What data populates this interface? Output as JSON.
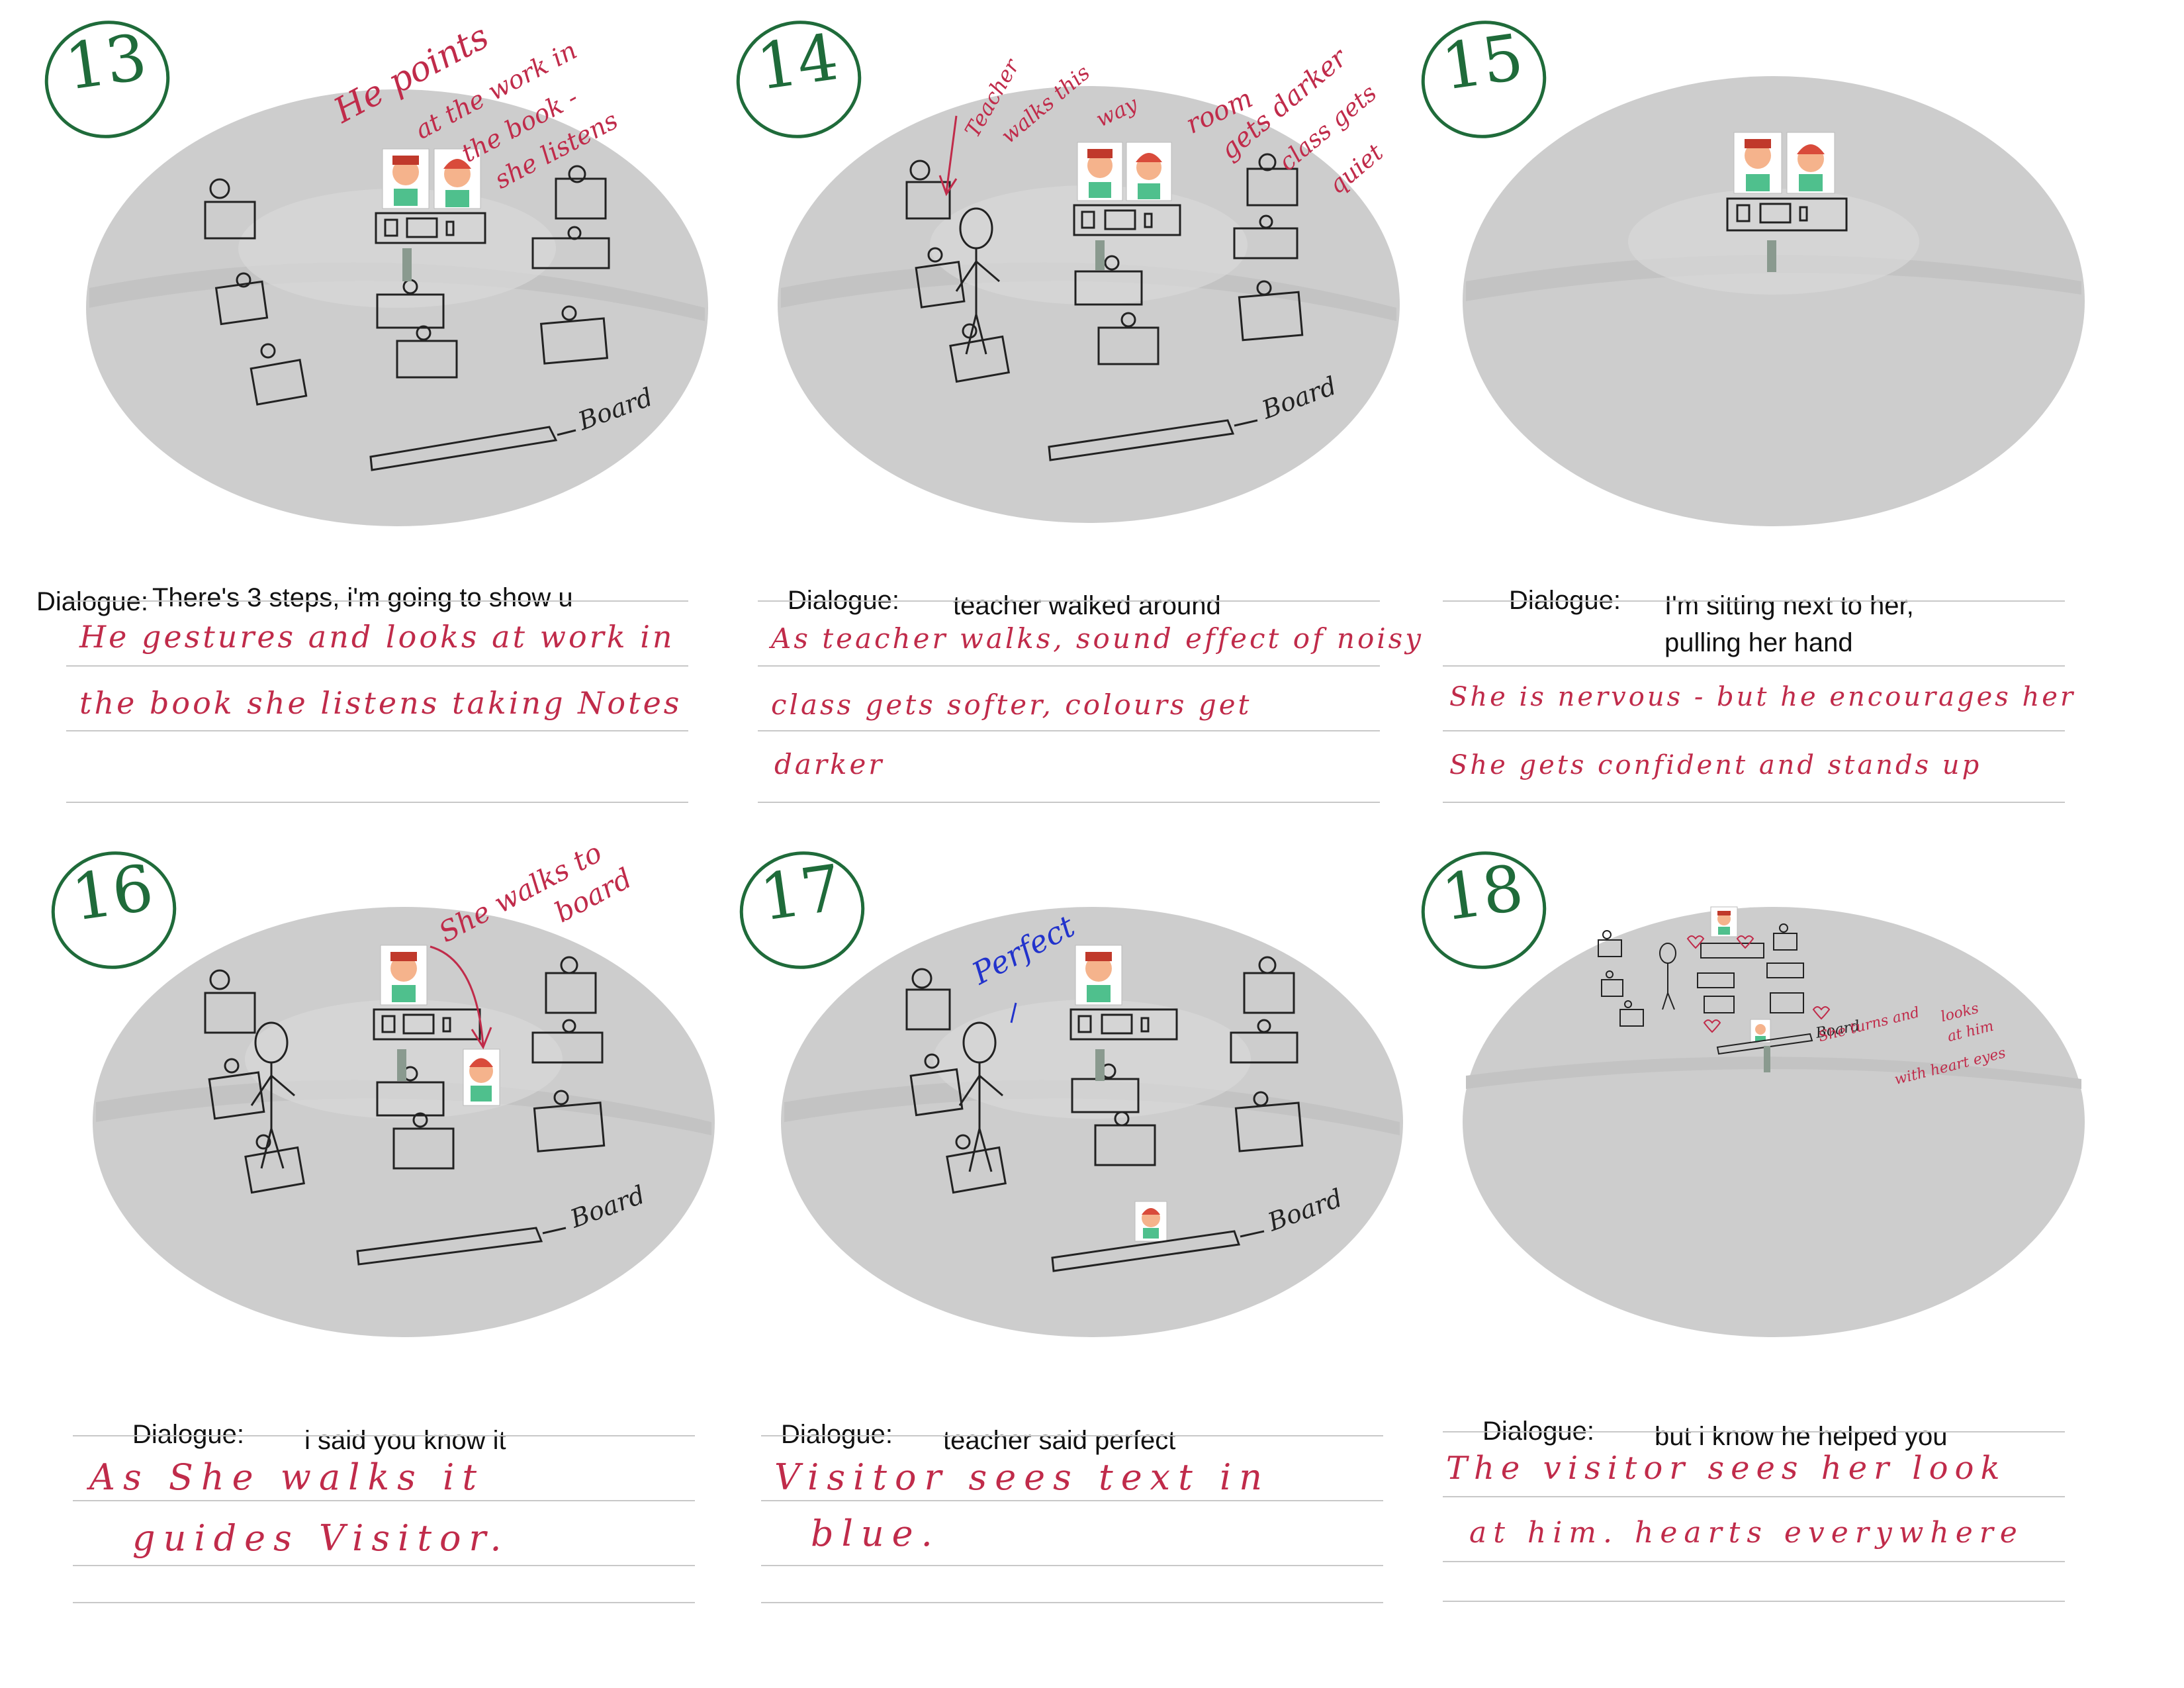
{
  "dialogue_label": "Dialogue:",
  "board_label": "Board",
  "colors": {
    "note_red": "#c02b4a",
    "circle_green": "#1f6b3a",
    "annot_blue": "#2233cc"
  },
  "panels": [
    {
      "number": "13",
      "dialogue": "There's 3 steps, i'm going to show u",
      "notes": [
        "He gestures and looks at work in",
        "the book  she listens taking Notes",
        ""
      ],
      "annotations": [
        "He points",
        "at the work in",
        "the book -",
        "she listens"
      ]
    },
    {
      "number": "14",
      "dialogue": "teacher walked around",
      "notes": [
        "As teacher walks, sound effect of noisy",
        "class gets softer, colours get",
        "darker"
      ],
      "annotations": [
        "Teacher",
        "walks this",
        "way",
        "room",
        "gets darker",
        "class gets",
        "quiet"
      ]
    },
    {
      "number": "15",
      "dialogue": "I'm sitting next to her, pulling her hand",
      "notes": [
        "",
        "She is nervous - but he encourages her",
        "She gets confident and stands up"
      ],
      "annotations": []
    },
    {
      "number": "16",
      "dialogue": "i said you know it",
      "notes": [
        "As She walks it",
        "guides Visitor.",
        ""
      ],
      "annotations": [
        "She walks to",
        "board"
      ]
    },
    {
      "number": "17",
      "dialogue": "teacher said perfect",
      "notes": [
        "Visitor sees text in",
        "blue.",
        ""
      ],
      "annotations": [
        "Perfect"
      ]
    },
    {
      "number": "18",
      "dialogue": "but i know he helped you",
      "notes": [
        "The visitor sees her look",
        "at him. hearts everywhere",
        ""
      ],
      "annotations": [
        "She turns and",
        "looks",
        "at him",
        "with heart eyes"
      ]
    }
  ]
}
